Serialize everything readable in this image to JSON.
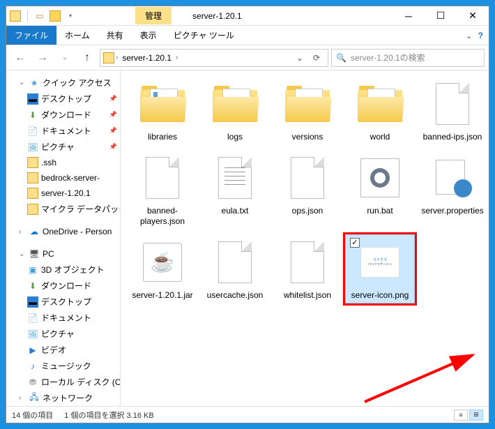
{
  "titlebar": {
    "context_tab": "管理",
    "title": "server-1.20.1"
  },
  "ribbon": {
    "file": "ファイル",
    "home": "ホーム",
    "share": "共有",
    "view": "表示",
    "context": "ピクチャ ツール"
  },
  "address": {
    "folder_name": "server-1.20.1",
    "search_placeholder": "server-1.20.1の検索"
  },
  "sidebar": {
    "quick_access": "クイック アクセス",
    "qa_items": [
      "デスクトップ",
      "ダウンロード",
      "ドキュメント",
      "ピクチャ",
      ".ssh",
      "bedrock-server-",
      "server-1.20.1",
      "マイクラ データパック"
    ],
    "onedrive": "OneDrive - Person",
    "pc": "PC",
    "pc_items": [
      "3D オブジェクト",
      "ダウンロード",
      "デスクトップ",
      "ドキュメント",
      "ピクチャ",
      "ビデオ",
      "ミュージック",
      "ローカル ディスク (C"
    ],
    "network": "ネットワーク"
  },
  "items": [
    {
      "name": "libraries",
      "type": "folder-blue"
    },
    {
      "name": "logs",
      "type": "folder-plain"
    },
    {
      "name": "versions",
      "type": "folder-plain"
    },
    {
      "name": "world",
      "type": "folder-plain"
    },
    {
      "name": "banned-ips.json",
      "type": "file"
    },
    {
      "name": "banned-players.json",
      "type": "file"
    },
    {
      "name": "eula.txt",
      "type": "file-text"
    },
    {
      "name": "ops.json",
      "type": "file"
    },
    {
      "name": "run.bat",
      "type": "bat"
    },
    {
      "name": "server.properties",
      "type": "prop"
    },
    {
      "name": "server-1.20.1.jar",
      "type": "jar"
    },
    {
      "name": "usercache.json",
      "type": "file"
    },
    {
      "name": "whitelist.json",
      "type": "file"
    },
    {
      "name": "server-icon.png",
      "type": "png",
      "selected": true,
      "highlighted": true
    }
  ],
  "statusbar": {
    "count": "14 個の項目",
    "selection": "1 個の項目を選択 3.16 KB"
  }
}
